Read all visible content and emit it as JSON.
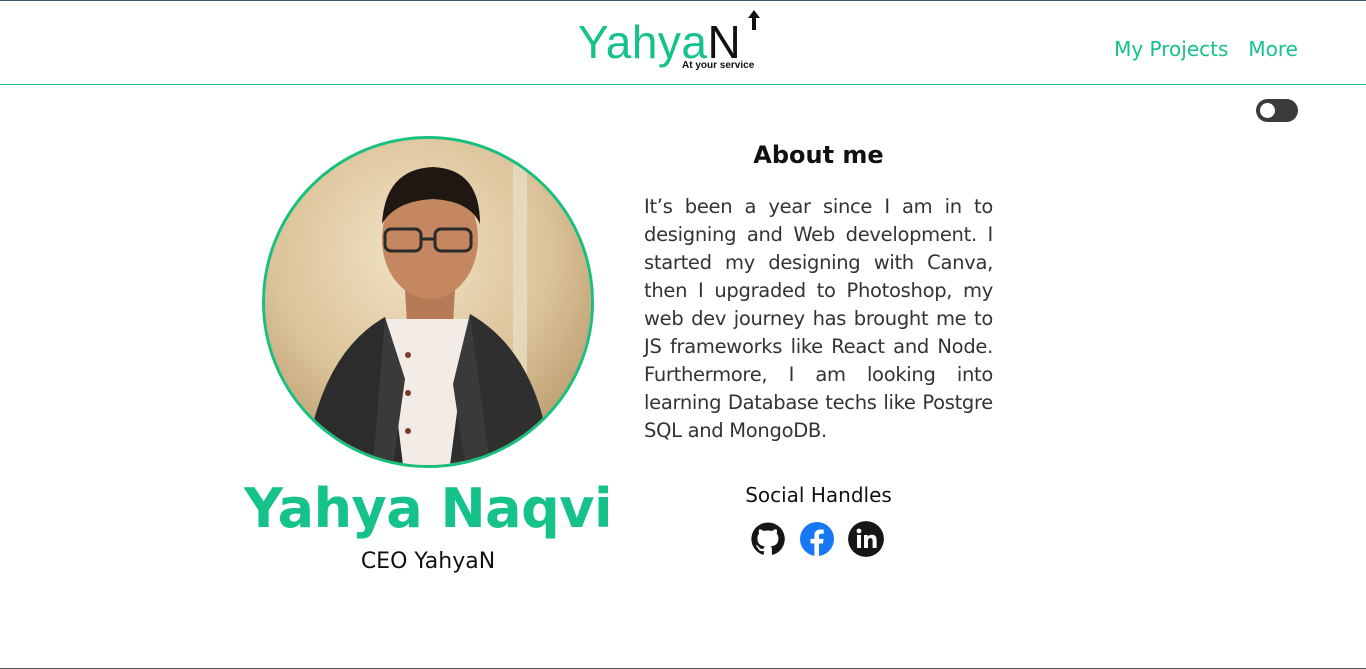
{
  "header": {
    "logo_main": "Yahya",
    "logo_n": "N",
    "logo_tagline": "At your service",
    "nav": [
      {
        "label": "My Projects"
      },
      {
        "label": "More"
      }
    ]
  },
  "theme_toggle": {
    "state": "off"
  },
  "profile": {
    "name": "Yahya Naqvi",
    "role": "CEO YahyaN"
  },
  "about": {
    "title": "About me",
    "text": "It’s been a year since I am in to designing and Web development. I started my designing with Canva, then I upgraded to Photoshop, my web dev journey has brought me to JS frameworks like React and Node. Furthermore, I am looking into learning Database techs like Postgre SQL and MongoDB."
  },
  "social": {
    "title": "Social Handles",
    "items": [
      {
        "icon": "github-icon",
        "color": "#161616"
      },
      {
        "icon": "facebook-icon",
        "color": "#1877f2"
      },
      {
        "icon": "linkedin-icon",
        "color": "#161616"
      }
    ]
  },
  "colors": {
    "accent": "#14c28a",
    "text": "#111111"
  }
}
